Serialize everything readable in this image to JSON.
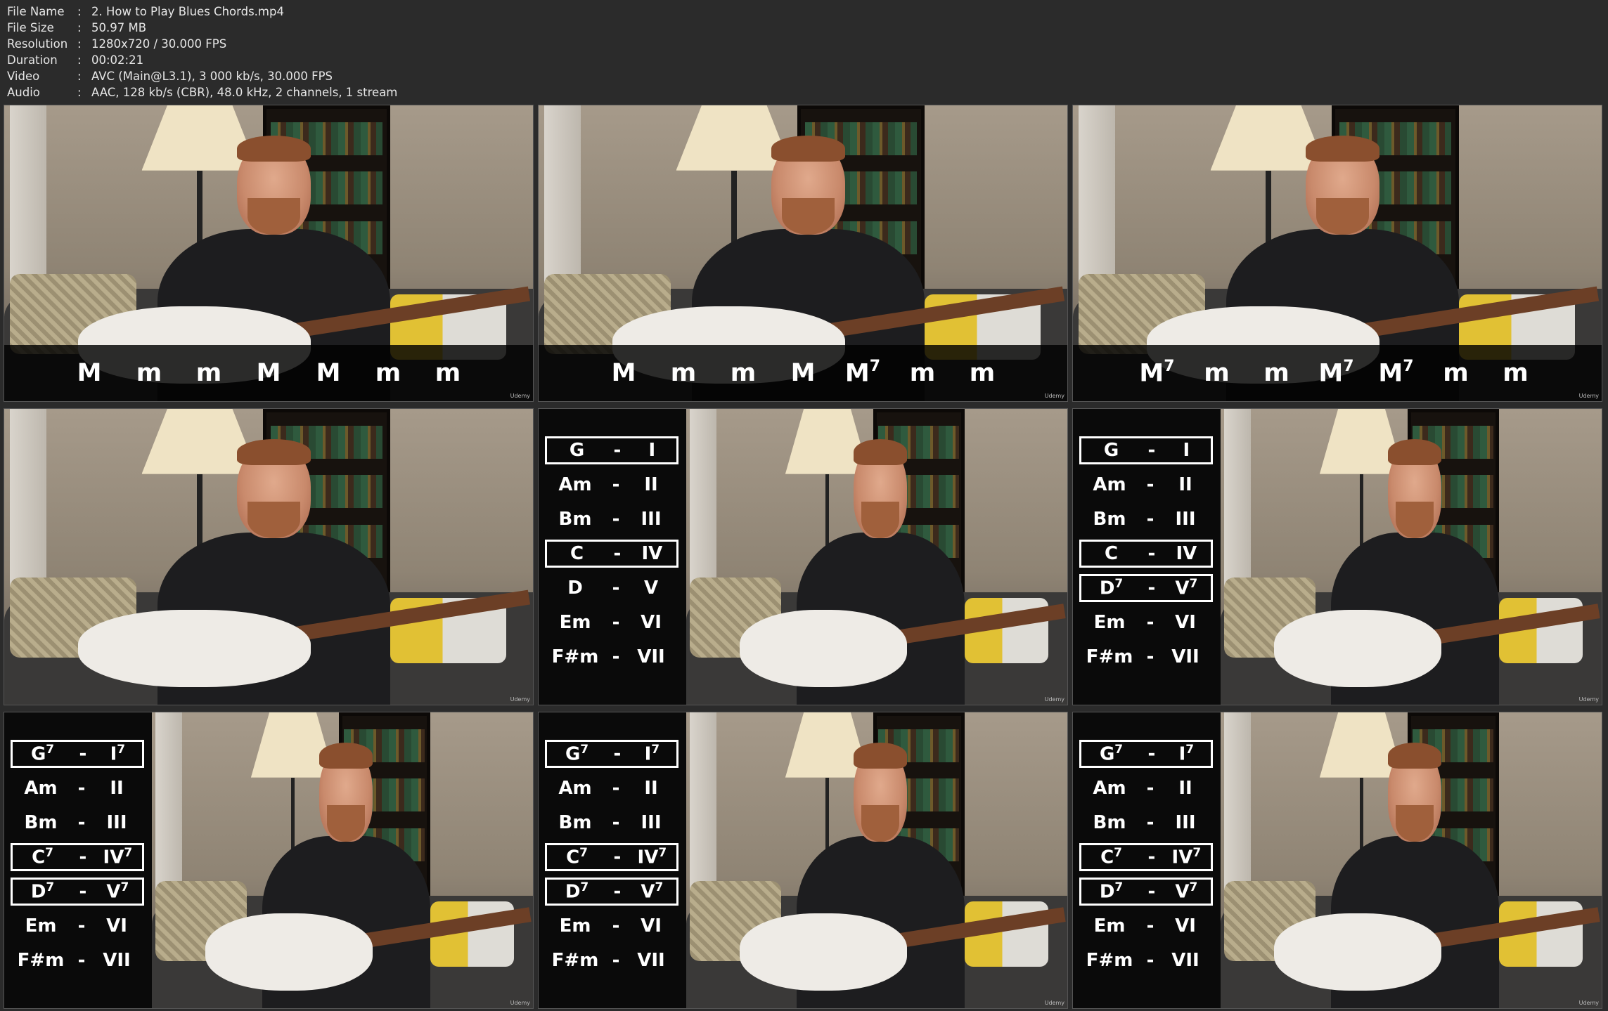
{
  "file_info": [
    {
      "key": "File Name",
      "value": "2. How to Play Blues Chords.mp4"
    },
    {
      "key": "File Size",
      "value": "50.97 MB"
    },
    {
      "key": "Resolution",
      "value": "1280x720 / 30.000 FPS"
    },
    {
      "key": "Duration",
      "value": "00:02:21"
    },
    {
      "key": "Video",
      "value": "AVC (Main@L3.1), 3 000 kb/s, 30.000 FPS"
    },
    {
      "key": "Audio",
      "value": "AAC, 128 kb/s (CBR), 48.0 kHz, 2 channels, 1 stream"
    }
  ],
  "separator": ":",
  "watermark": "Udemy",
  "frames": [
    {
      "type": "bar",
      "items": [
        {
          "t": "M",
          "s": ""
        },
        {
          "t": "m",
          "s": ""
        },
        {
          "t": "m",
          "s": ""
        },
        {
          "t": "M",
          "s": ""
        },
        {
          "t": "M",
          "s": ""
        },
        {
          "t": "m",
          "s": ""
        },
        {
          "t": "m",
          "s": ""
        }
      ]
    },
    {
      "type": "bar",
      "items": [
        {
          "t": "M",
          "s": ""
        },
        {
          "t": "m",
          "s": ""
        },
        {
          "t": "m",
          "s": ""
        },
        {
          "t": "M",
          "s": ""
        },
        {
          "t": "M",
          "s": "7"
        },
        {
          "t": "m",
          "s": ""
        },
        {
          "t": "m",
          "s": ""
        }
      ]
    },
    {
      "type": "bar",
      "items": [
        {
          "t": "M",
          "s": "7"
        },
        {
          "t": "m",
          "s": ""
        },
        {
          "t": "m",
          "s": ""
        },
        {
          "t": "M",
          "s": "7"
        },
        {
          "t": "M",
          "s": "7"
        },
        {
          "t": "m",
          "s": ""
        },
        {
          "t": "m",
          "s": ""
        }
      ]
    },
    {
      "type": "plain"
    },
    {
      "type": "panel",
      "rows": [
        {
          "c": "G",
          "cs": "",
          "r": "I",
          "rs": "",
          "boxed": true
        },
        {
          "c": "Am",
          "cs": "",
          "r": "II",
          "rs": "",
          "boxed": false
        },
        {
          "c": "Bm",
          "cs": "",
          "r": "III",
          "rs": "",
          "boxed": false
        },
        {
          "c": "C",
          "cs": "",
          "r": "IV",
          "rs": "",
          "boxed": true
        },
        {
          "c": "D",
          "cs": "",
          "r": "V",
          "rs": "",
          "boxed": false
        },
        {
          "c": "Em",
          "cs": "",
          "r": "VI",
          "rs": "",
          "boxed": false
        },
        {
          "c": "F#m",
          "cs": "",
          "r": "VII",
          "rs": "",
          "boxed": false
        }
      ]
    },
    {
      "type": "panel",
      "rows": [
        {
          "c": "G",
          "cs": "",
          "r": "I",
          "rs": "",
          "boxed": true
        },
        {
          "c": "Am",
          "cs": "",
          "r": "II",
          "rs": "",
          "boxed": false
        },
        {
          "c": "Bm",
          "cs": "",
          "r": "III",
          "rs": "",
          "boxed": false
        },
        {
          "c": "C",
          "cs": "",
          "r": "IV",
          "rs": "",
          "boxed": true
        },
        {
          "c": "D",
          "cs": "7",
          "r": "V",
          "rs": "7",
          "boxed": true
        },
        {
          "c": "Em",
          "cs": "",
          "r": "VI",
          "rs": "",
          "boxed": false
        },
        {
          "c": "F#m",
          "cs": "",
          "r": "VII",
          "rs": "",
          "boxed": false
        }
      ]
    },
    {
      "type": "panel",
      "rows": [
        {
          "c": "G",
          "cs": "7",
          "r": "I",
          "rs": "7",
          "boxed": true
        },
        {
          "c": "Am",
          "cs": "",
          "r": "II",
          "rs": "",
          "boxed": false
        },
        {
          "c": "Bm",
          "cs": "",
          "r": "III",
          "rs": "",
          "boxed": false
        },
        {
          "c": "C",
          "cs": "7",
          "r": "IV",
          "rs": "7",
          "boxed": true
        },
        {
          "c": "D",
          "cs": "7",
          "r": "V",
          "rs": "7",
          "boxed": true
        },
        {
          "c": "Em",
          "cs": "",
          "r": "VI",
          "rs": "",
          "boxed": false
        },
        {
          "c": "F#m",
          "cs": "",
          "r": "VII",
          "rs": "",
          "boxed": false
        }
      ]
    },
    {
      "type": "panel",
      "rows": [
        {
          "c": "G",
          "cs": "7",
          "r": "I",
          "rs": "7",
          "boxed": true
        },
        {
          "c": "Am",
          "cs": "",
          "r": "II",
          "rs": "",
          "boxed": false
        },
        {
          "c": "Bm",
          "cs": "",
          "r": "III",
          "rs": "",
          "boxed": false
        },
        {
          "c": "C",
          "cs": "7",
          "r": "IV",
          "rs": "7",
          "boxed": true
        },
        {
          "c": "D",
          "cs": "7",
          "r": "V",
          "rs": "7",
          "boxed": true
        },
        {
          "c": "Em",
          "cs": "",
          "r": "VI",
          "rs": "",
          "boxed": false
        },
        {
          "c": "F#m",
          "cs": "",
          "r": "VII",
          "rs": "",
          "boxed": false
        }
      ]
    },
    {
      "type": "panel",
      "rows": [
        {
          "c": "G",
          "cs": "7",
          "r": "I",
          "rs": "7",
          "boxed": true
        },
        {
          "c": "Am",
          "cs": "",
          "r": "II",
          "rs": "",
          "boxed": false
        },
        {
          "c": "Bm",
          "cs": "",
          "r": "III",
          "rs": "",
          "boxed": false
        },
        {
          "c": "C",
          "cs": "7",
          "r": "IV",
          "rs": "7",
          "boxed": true
        },
        {
          "c": "D",
          "cs": "7",
          "r": "V",
          "rs": "7",
          "boxed": true
        },
        {
          "c": "Em",
          "cs": "",
          "r": "VI",
          "rs": "",
          "boxed": false
        },
        {
          "c": "F#m",
          "cs": "",
          "r": "VII",
          "rs": "",
          "boxed": false
        }
      ]
    }
  ]
}
